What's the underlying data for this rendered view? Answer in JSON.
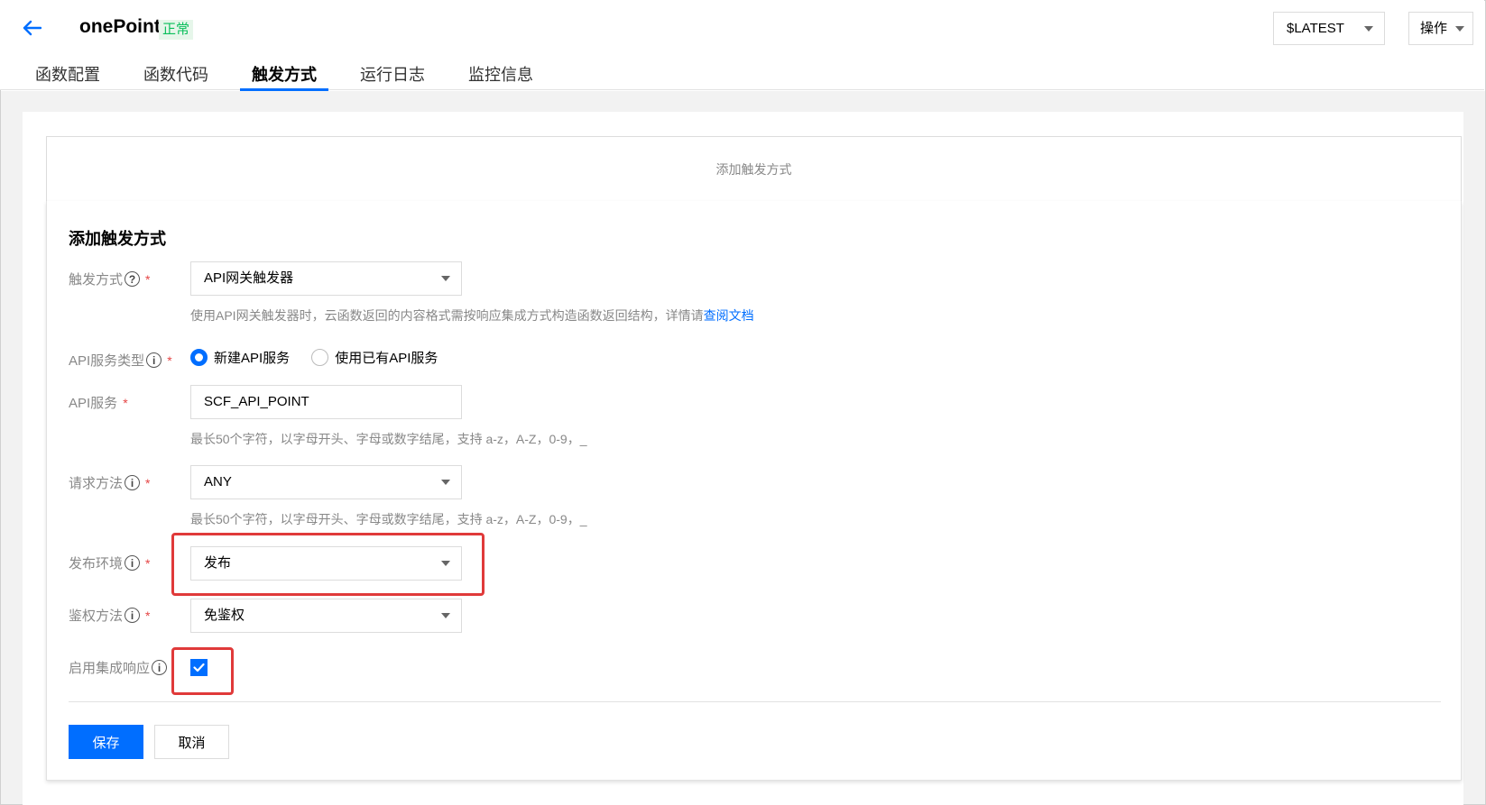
{
  "header": {
    "title": "onePoint",
    "status": "正常",
    "version": "$LATEST",
    "ops_label": "操作"
  },
  "tabs": [
    {
      "label": "函数配置"
    },
    {
      "label": "函数代码"
    },
    {
      "label": "触发方式",
      "active": true
    },
    {
      "label": "运行日志"
    },
    {
      "label": "监控信息"
    }
  ],
  "add_trigger_bar": "添加触发方式",
  "form": {
    "title": "添加触发方式",
    "trigger": {
      "label": "触发方式",
      "value": "API网关触发器",
      "help_text": "使用API网关触发器时，云函数返回的内容格式需按响应集成方式构造函数返回结构，详情请",
      "help_link": "查阅文档"
    },
    "api_service_type": {
      "label": "API服务类型",
      "options": [
        "新建API服务",
        "使用已有API服务"
      ],
      "selected": "新建API服务"
    },
    "api_service": {
      "label": "API服务",
      "value": "SCF_API_POINT",
      "help_text": "最长50个字符，以字母开头、字母或数字结尾，支持 a-z，A-Z，0-9，_"
    },
    "request_method": {
      "label": "请求方法",
      "value": "ANY",
      "help_text": "最长50个字符，以字母开头、字母或数字结尾，支持 a-z，A-Z，0-9，_"
    },
    "env": {
      "label": "发布环境",
      "value": "发布"
    },
    "auth": {
      "label": "鉴权方法",
      "value": "免鉴权"
    },
    "integration": {
      "label": "启用集成响应",
      "checked": true
    },
    "save_label": "保存",
    "cancel_label": "取消"
  },
  "colors": {
    "primary": "#006eff",
    "success": "#0abf5b",
    "highlight": "#e03a3a",
    "required": "#e54545"
  }
}
